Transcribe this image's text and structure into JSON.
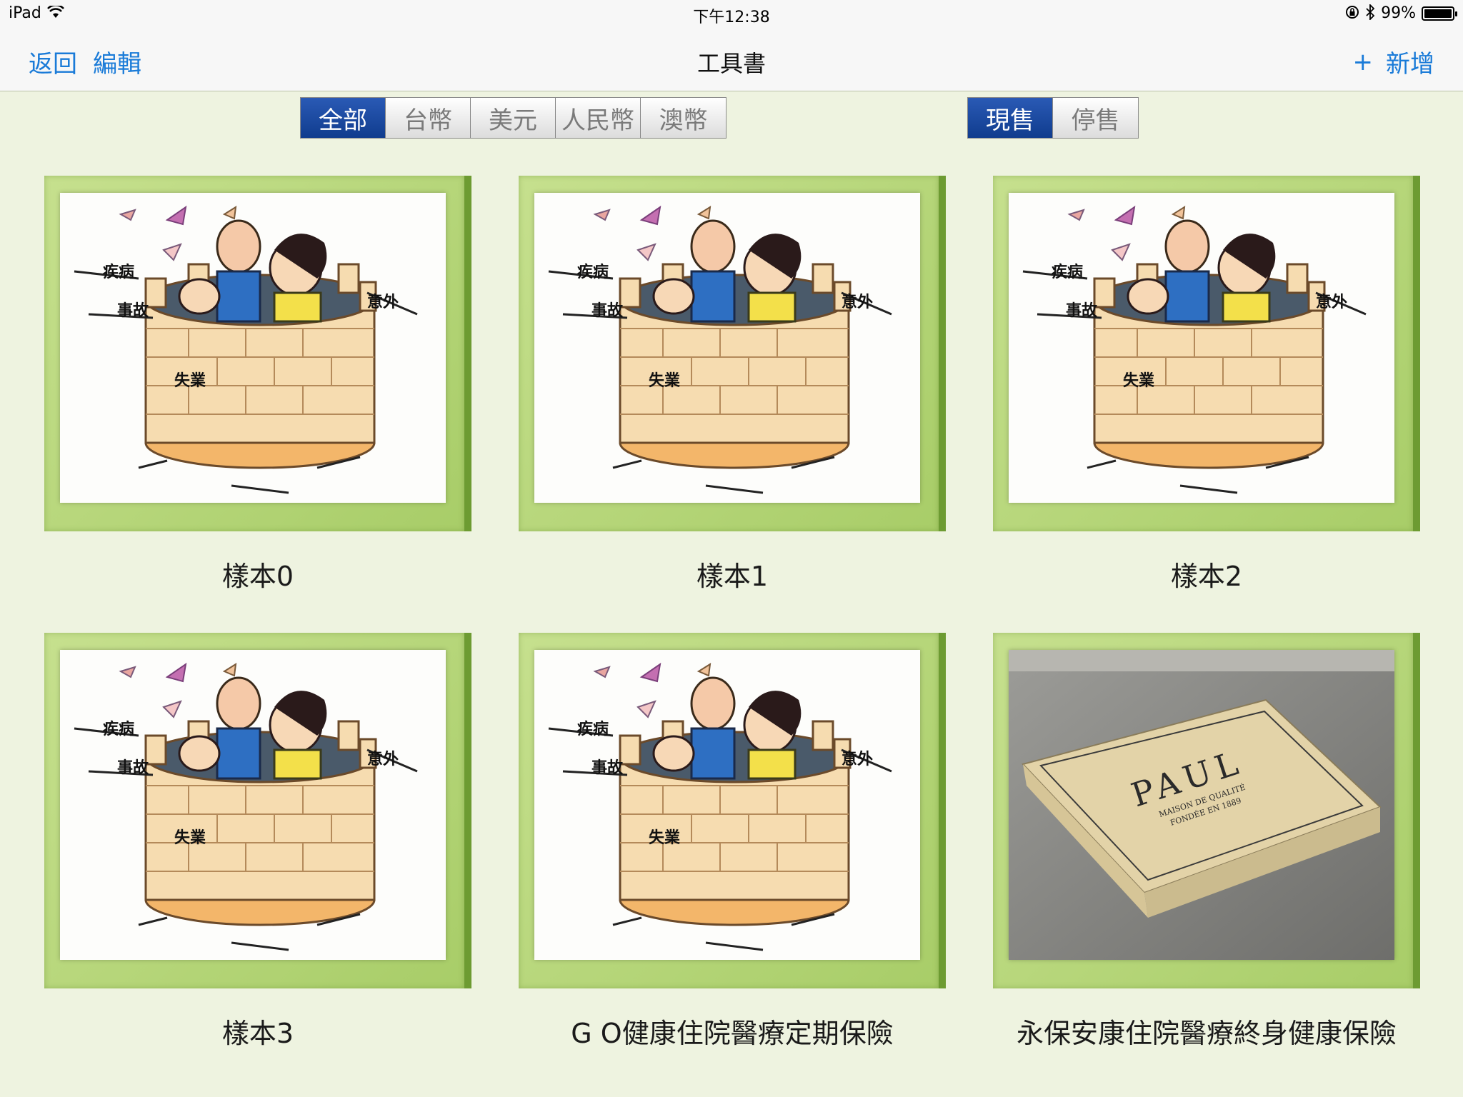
{
  "status": {
    "device": "iPad",
    "time": "下午12:38",
    "battery": "99%",
    "battery_level": 0.99
  },
  "nav": {
    "back": "返回",
    "edit": "編輯",
    "title": "工具書",
    "add": "新增",
    "add_icon": "+"
  },
  "filters": {
    "currency": [
      "全部",
      "台幣",
      "美元",
      "人民幣",
      "澳幣"
    ],
    "sale": [
      "現售",
      "停售"
    ]
  },
  "illustration": {
    "words": [
      "疾病",
      "事故",
      "意外",
      "失業"
    ]
  },
  "paul": {
    "brand": "PAUL",
    "line1": "MAISON DE QUALITÉ",
    "line2": "FONDÉE EN 1889"
  },
  "cards": [
    {
      "label": "樣本0"
    },
    {
      "label": "樣本1"
    },
    {
      "label": "樣本2"
    },
    {
      "label": "樣本3"
    },
    {
      "label": "G O健康住院醫療定期保險"
    },
    {
      "label": "永保安康住院醫療終身健康保險"
    }
  ],
  "colors": {
    "accent": "#1a7bd8",
    "segment_active": "#1a4aa0",
    "frame_light": "#b8d97a",
    "frame_dark": "#6d9b32",
    "background": "#eef3e0"
  }
}
